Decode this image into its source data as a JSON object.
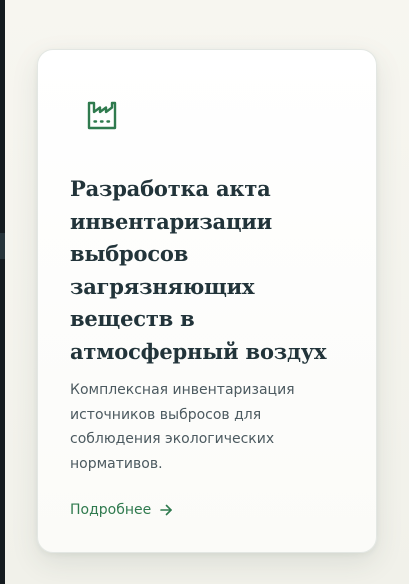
{
  "card": {
    "icon": "factory-icon",
    "title": "Разработка акта инвентаризации выбросов загрязняющих веществ в атмосферный воздух",
    "description": "Комплексная инвентаризация источников выбросов для соблюдения экологических нормативов.",
    "link_label": "Подробнее",
    "link_icon": "arrow-right-icon"
  },
  "colors": {
    "accent": "#2f7a4e",
    "title": "#22343a",
    "text": "#4c5a60",
    "card_background": "#ffffff",
    "page_background": "#f4f4ee"
  }
}
